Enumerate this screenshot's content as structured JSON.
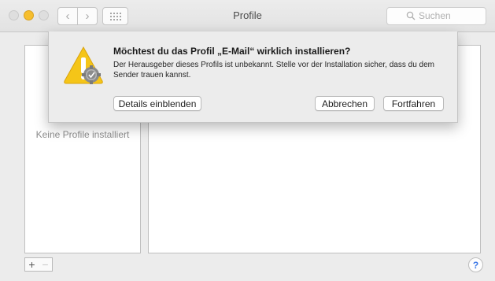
{
  "window": {
    "title": "Profile"
  },
  "toolbar": {
    "back_glyph": "‹",
    "forward_glyph": "›",
    "search_placeholder": "Suchen"
  },
  "sidebar": {
    "empty_text": "Keine Profile installiert"
  },
  "bottom_bar": {
    "add_label": "+",
    "remove_label": "−",
    "help_label": "?"
  },
  "dialog": {
    "heading": "Möchtest du das Profil „E-Mail“ wirklich installieren?",
    "body": "Der Herausgeber dieses Profils ist unbekannt. Stelle vor der Installation sicher, dass du dem Sender trauen kannst.",
    "details_button": "Details einblenden",
    "cancel_button": "Abbrechen",
    "continue_button": "Fortfahren"
  },
  "colors": {
    "minimize_light": "#f6be2e",
    "help_accent": "#3b78e7",
    "warning_yellow": "#f5c518"
  },
  "icons": [
    "chevron-left-icon",
    "chevron-right-icon",
    "grid-icon",
    "search-icon",
    "warning-gear-icon",
    "help-icon"
  ]
}
